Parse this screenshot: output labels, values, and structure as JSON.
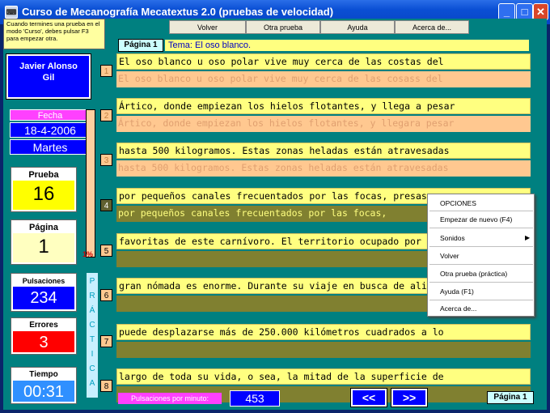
{
  "window": {
    "title": "Curso de Mecanografía Mecatextus 2.0 (pruebas de velocidad)"
  },
  "hint": "Cuando termines una prueba en el modo 'Curso', debes pulsar F3 para empezar otra.",
  "toolbar": {
    "volver": "Volver",
    "otra": "Otra prueba",
    "ayuda": "Ayuda",
    "acerca": "Acerca de..."
  },
  "user": {
    "name1": "Javier Alonso",
    "name2": "Gil"
  },
  "fecha": {
    "label": "Fecha",
    "date": "18-4-2006",
    "day": "Martes"
  },
  "prueba": {
    "label": "Prueba",
    "value": "16"
  },
  "pagina": {
    "label": "Página",
    "value": "1"
  },
  "pulsaciones": {
    "label": "Pulsaciones",
    "value": "234"
  },
  "errores": {
    "label": "Errores",
    "value": "3"
  },
  "tiempo": {
    "label": "Tiempo",
    "value": "00:31"
  },
  "progress": {
    "label": "1%",
    "percent": 1
  },
  "practica": [
    "P",
    "R",
    "Á",
    "C",
    "T",
    "I",
    "C",
    "A"
  ],
  "page_badge": "Página 1",
  "tema": "Tema: El oso blanco.",
  "lines": [
    {
      "num": "1",
      "model": "El oso blanco u oso polar vive muy cerca de las costas del",
      "typed": "El oso blanco u oso polar vive muy cerca de las cosass del",
      "state": "done"
    },
    {
      "num": "2",
      "model": "Ártico, donde empiezan los hielos flotantes, y llega a pesar",
      "typed": "Ártico, donde empiezan los hielos flotantes, y llegara pesar",
      "state": "done"
    },
    {
      "num": "3",
      "model": "hasta 500 kilogramos. Estas zonas heladas están atravesadas",
      "typed": "hasta 500 kilogramos. Estas zonas heladas están atravesadas",
      "state": "done"
    },
    {
      "num": "4",
      "model": "por pequeños canales frecuentados por las focas, presas",
      "typed": "por pequeños canales frecuentados por las focas,",
      "state": "cur"
    },
    {
      "num": "5",
      "model": "favoritas de este carnívoro. El territorio ocupado por este",
      "typed": "",
      "state": "todo"
    },
    {
      "num": "6",
      "model": "gran nómada es enorme. Durante su viaje en busca de alimento",
      "typed": "",
      "state": "todo"
    },
    {
      "num": "7",
      "model": "puede desplazarse más de 250.000 kilómetros cuadrados a lo",
      "typed": "",
      "state": "todo"
    },
    {
      "num": "8",
      "model": "largo de toda su vida, o sea, la mitad de la superficie de",
      "typed": "",
      "state": "todo"
    }
  ],
  "menu": {
    "title": "OPCIONES",
    "items": [
      "Empezar de nuevo (F4)",
      "Sonidos",
      "Volver",
      "Otra prueba (práctica)",
      "Ayuda (F1)",
      "Acerca de..."
    ]
  },
  "ppm": {
    "label": "Pulsaciones por minuto:",
    "value": "453"
  },
  "nav": {
    "prev": "<<",
    "next": ">>"
  },
  "page_badge2": "Página 1"
}
